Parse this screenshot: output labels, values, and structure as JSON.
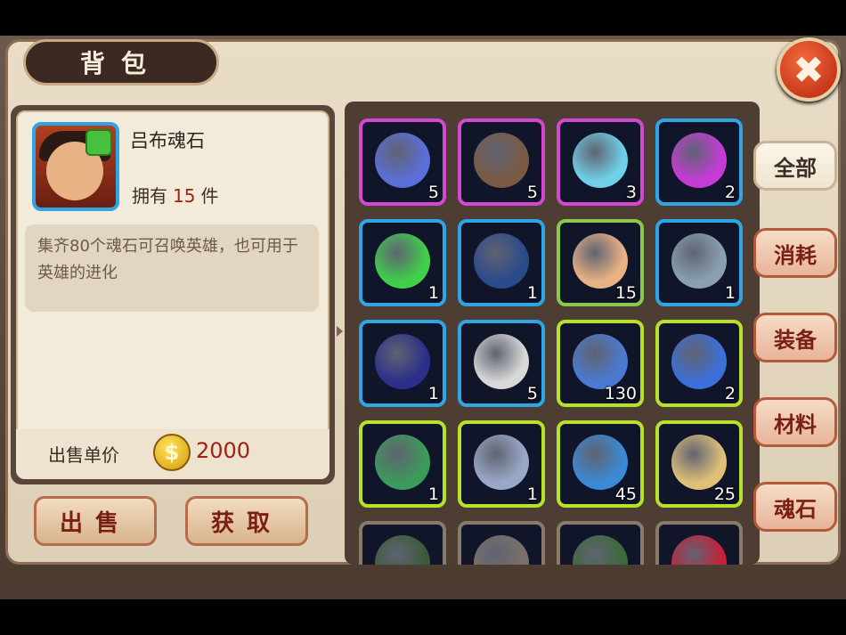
{
  "header": {
    "title": "背包",
    "close_symbol": "✖"
  },
  "detail": {
    "item_name": "吕布魂石",
    "owned_prefix": "拥有",
    "owned_count": "15",
    "owned_suffix": "件",
    "description": "集齐80个魂石可召唤英雄，也可用于英雄的进化",
    "price_label": "出售单价",
    "coin_symbol": "$",
    "price": "2000"
  },
  "buttons": {
    "sell": "出售",
    "obtain": "获取"
  },
  "tabs": [
    {
      "label": "全部",
      "active": true
    },
    {
      "label": "消耗",
      "active": false
    },
    {
      "label": "装备",
      "active": false
    },
    {
      "label": "材料",
      "active": false
    },
    {
      "label": "魂石",
      "active": false
    }
  ],
  "items": [
    {
      "name": "thread-spool-icon",
      "count": "5",
      "border": "#d447d0",
      "color": "#5a6fd8"
    },
    {
      "name": "net-stone-icon",
      "count": "5",
      "border": "#d447d0",
      "color": "#7a5a44"
    },
    {
      "name": "magic-orb-icon",
      "count": "3",
      "border": "#d447d0",
      "color": "#6fd0e8"
    },
    {
      "name": "purple-potion-icon",
      "count": "2",
      "border": "#2ea6e6",
      "color": "#c53bd6"
    },
    {
      "name": "green-vial-icon",
      "count": "1",
      "border": "#2ea6e6",
      "color": "#3fcf4a"
    },
    {
      "name": "wolf-hero-soulstone-icon",
      "count": "1",
      "border": "#2ea6e6",
      "color": "#2b4a8a"
    },
    {
      "name": "lubu-soulstone-icon",
      "count": "15",
      "border": "#8cc94a",
      "color": "#e8b285"
    },
    {
      "name": "stone-bow-icon",
      "count": "1",
      "border": "#2ea6e6",
      "color": "#8aa0b0"
    },
    {
      "name": "pirate-hat-icon",
      "count": "1",
      "border": "#2ea6e6",
      "color": "#2b2f8a"
    },
    {
      "name": "silver-stone-icon",
      "count": "5",
      "border": "#2ea6e6",
      "color": "#d8d8d8"
    },
    {
      "name": "blue-scroll-icon",
      "count": "130",
      "border": "#b6e22a",
      "color": "#4a7ad0"
    },
    {
      "name": "gem-amulet-icon",
      "count": "2",
      "border": "#b6e22a",
      "color": "#3c6fd8"
    },
    {
      "name": "jade-dragon-icon",
      "count": "1",
      "border": "#b6e22a",
      "color": "#3c9a5a"
    },
    {
      "name": "broken-blade-icon",
      "count": "1",
      "border": "#b6e22a",
      "color": "#9aa8c8"
    },
    {
      "name": "rune-book-icon",
      "count": "45",
      "border": "#b6e22a",
      "color": "#3a8ad6"
    },
    {
      "name": "sealed-scroll-icon",
      "count": "25",
      "border": "#b6e22a",
      "color": "#e0c078"
    },
    {
      "name": "vine-item-icon",
      "count": "",
      "border": "#8a7a6a",
      "color": "#3a5a3a"
    },
    {
      "name": "gray-item-icon",
      "count": "",
      "border": "#8a7a6a",
      "color": "#7a7068"
    },
    {
      "name": "leaf-item-icon",
      "count": "",
      "border": "#8a7a6a",
      "color": "#3a6a3a"
    },
    {
      "name": "ruby-item-icon",
      "count": "",
      "border": "#8a7a6a",
      "color": "#c8203a"
    }
  ]
}
